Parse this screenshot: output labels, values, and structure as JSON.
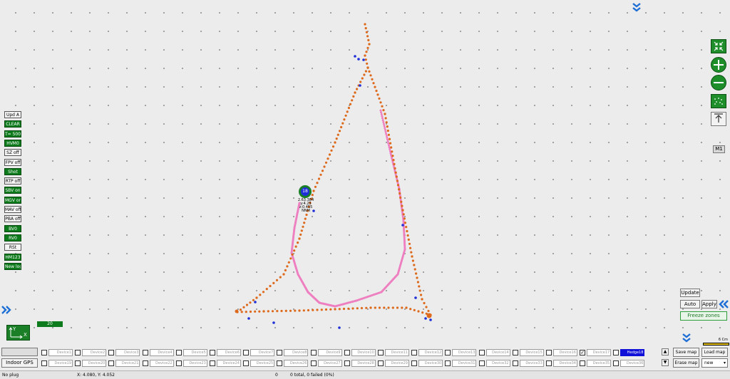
{
  "left_panel": {
    "buttons": [
      {
        "label": "Upd A",
        "style": "white"
      },
      {
        "label": "CLEAR",
        "style": "green"
      },
      {
        "label": "T= 500",
        "style": "green"
      },
      {
        "label": "HVM0",
        "style": "green"
      },
      {
        "label": "SZ off",
        "style": "white"
      },
      {
        "label": "FPV off",
        "style": "white"
      },
      {
        "label": "Shot",
        "style": "green"
      },
      {
        "label": "RTP off",
        "style": "white"
      },
      {
        "label": "SBV on",
        "style": "green"
      },
      {
        "label": "MGV on",
        "style": "green"
      },
      {
        "label": "MAV off",
        "style": "white"
      },
      {
        "label": "PBA off",
        "style": "white"
      },
      {
        "label": "BV0",
        "style": "green"
      },
      {
        "label": "RV0",
        "style": "green"
      },
      {
        "label": "RSt",
        "style": "white"
      },
      {
        "label": "HM123",
        "style": "green"
      },
      {
        "label": "New log",
        "style": "green"
      }
    ]
  },
  "map": {
    "hedge_number": "18",
    "hedge_info": [
      "2.63.384",
      "y:4.25",
      "z:0.455",
      "NNM"
    ],
    "axis_x": "X",
    "axis_y": "Y",
    "zoom_badge": "20",
    "scale_label": "6 Cm",
    "m1_label": "M1"
  },
  "right_controls": {
    "update": "Update",
    "auto": "Auto",
    "apply": "Apply",
    "freeze": "Freeze zones",
    "save_map": "Save map",
    "load_map": "Load map",
    "erase_map": "Erase map",
    "load_select": "new"
  },
  "bottom": {
    "indoor_gps": "Indoor GPS",
    "row1": [
      "Device1",
      "Device2",
      "Device3",
      "Device4",
      "Device5",
      "Device6",
      "Device7",
      "Device8",
      "Device9",
      "Device10",
      "Device11",
      "Device12",
      "Device13",
      "Device14",
      "Device15",
      "Device16",
      "Device17",
      "Hedge18"
    ],
    "row2": [
      "Device19",
      "Device20",
      "Device21",
      "Device22",
      "Device23",
      "Device24",
      "Device25",
      "Device26",
      "Device27",
      "Device28",
      "Device29",
      "Device30",
      "Device31",
      "Device32",
      "Device33",
      "Device34",
      "Device35",
      "Device36"
    ],
    "row1_checked": [
      false,
      false,
      false,
      false,
      false,
      false,
      false,
      false,
      false,
      false,
      false,
      false,
      false,
      false,
      false,
      false,
      true,
      false
    ],
    "selected_label_index": 17
  },
  "status": {
    "plug": "No plug",
    "coords": "X: 4.080, Y: 4.052",
    "count": "0",
    "result": "0 total, 0 failed (0%)"
  },
  "colors": {
    "track_orange": "#dd6a1c",
    "track_pink": "#ee7fc0",
    "beacon_blue": "#1f2fd8",
    "button_green": "#0d7a1c",
    "selected_blue": "#1010d8",
    "chevron_blue": "#1d6fd6"
  }
}
